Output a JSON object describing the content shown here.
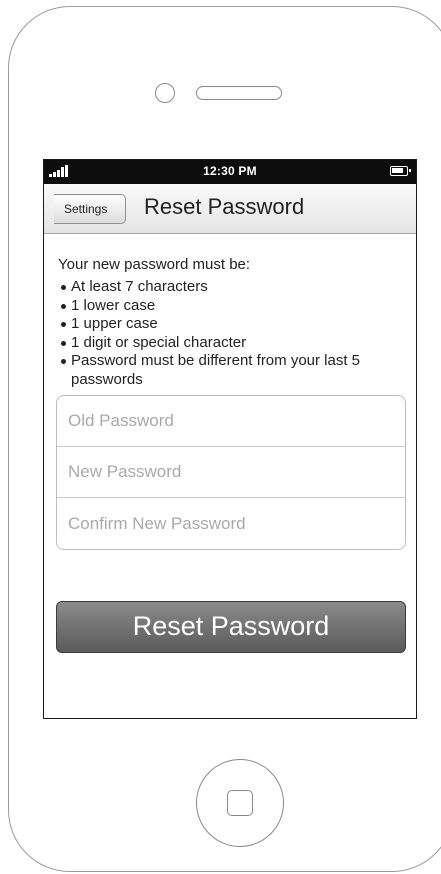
{
  "status_bar": {
    "time": "12:30 PM",
    "signal_icon": "signal-bars-icon",
    "battery_icon": "battery-icon"
  },
  "nav": {
    "back_label": "Settings",
    "title": "Reset Password"
  },
  "requirements": {
    "intro": "Your new password must be:",
    "items": [
      "At least 7 characters",
      "1  lower case",
      "1 upper case",
      "1 digit or special character",
      "Password must be different from your last 5 passwords"
    ]
  },
  "form": {
    "old_password": {
      "placeholder": "Old Password",
      "value": ""
    },
    "new_password": {
      "placeholder": "New Password",
      "value": ""
    },
    "confirm_password": {
      "placeholder": "Confirm New Password",
      "value": ""
    },
    "submit_label": "Reset Password"
  },
  "colors": {
    "button_gradient_top": "#8a8a8a",
    "button_gradient_bottom": "#5b5b5b",
    "status_bar": "#0d0d0d"
  }
}
